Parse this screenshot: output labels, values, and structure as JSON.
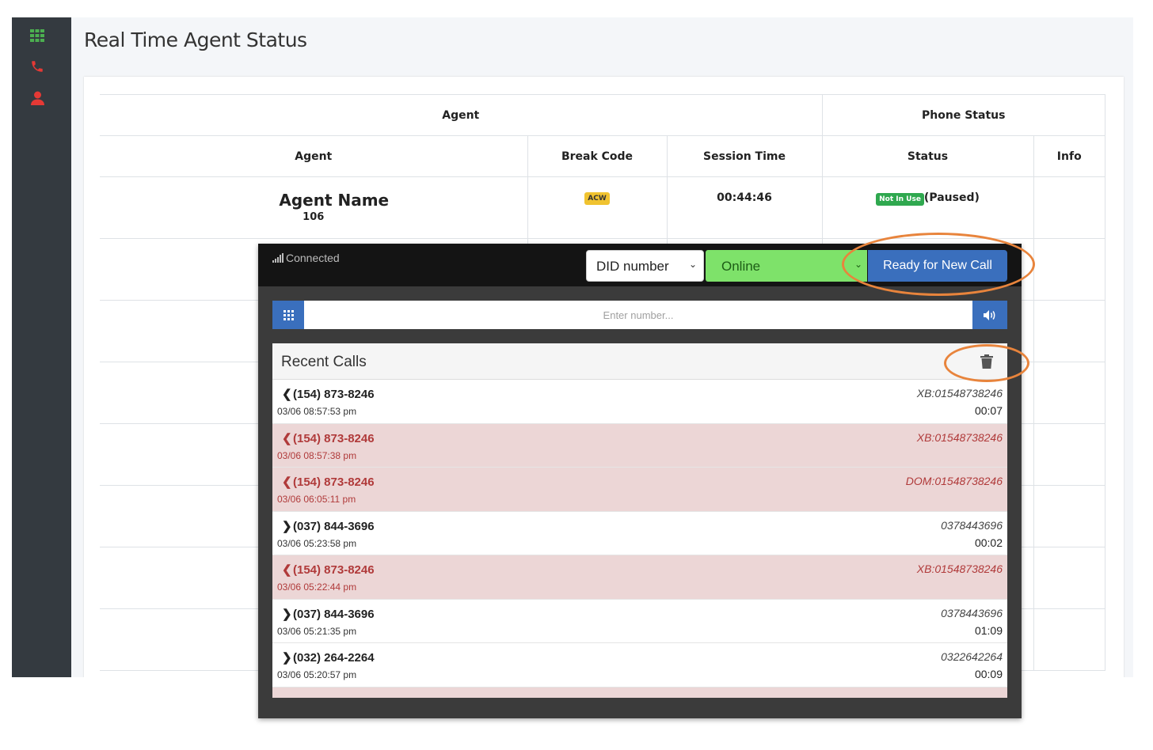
{
  "page": {
    "title": "Real Time Agent Status"
  },
  "sidebar": {
    "icons": [
      {
        "name": "grid-icon",
        "color": "#4caf50"
      },
      {
        "name": "phone-icon",
        "color": "#e53935"
      },
      {
        "name": "user-icon",
        "color": "#e53935"
      }
    ]
  },
  "table": {
    "group_headers": {
      "agent": "Agent",
      "phone_status": "Phone Status"
    },
    "columns": [
      "Agent",
      "Break Code",
      "Session Time",
      "Status",
      "Info"
    ],
    "row": {
      "agent_name": "Agent Name",
      "agent_ext": "106",
      "break_code": "ACW",
      "session_time": "00:44:46",
      "status_badge": "Not In Use",
      "status_text": "(Paused)",
      "info": ""
    }
  },
  "phone": {
    "connection": "Connected",
    "did_select": "DID number",
    "status_select": "Online",
    "ready_button": "Ready for New Call",
    "number_placeholder": "Enter number...",
    "recent_title": "Recent Calls",
    "colors": {
      "accent": "#3a6fbd",
      "online": "#7ee26a",
      "missed_bg": "#ecd6d6",
      "annotation": "#e8843c"
    },
    "calls": [
      {
        "direction": "in",
        "number": "(154) 873-8246",
        "when": "03/06 08:57:53 pm",
        "tag": "XB:01548738246",
        "duration": "00:07",
        "missed": false
      },
      {
        "direction": "in",
        "number": "(154) 873-8246",
        "when": "03/06 08:57:38 pm",
        "tag": "XB:01548738246",
        "duration": "",
        "missed": true
      },
      {
        "direction": "in",
        "number": "(154) 873-8246",
        "when": "03/06 06:05:11 pm",
        "tag": "DOM:01548738246",
        "duration": "",
        "missed": true
      },
      {
        "direction": "out",
        "number": "(037) 844-3696",
        "when": "03/06 05:23:58 pm",
        "tag": "0378443696",
        "duration": "00:02",
        "missed": false
      },
      {
        "direction": "in",
        "number": "(154) 873-8246",
        "when": "03/06 05:22:44 pm",
        "tag": "XB:01548738246",
        "duration": "",
        "missed": true
      },
      {
        "direction": "out",
        "number": "(037) 844-3696",
        "when": "03/06 05:21:35 pm",
        "tag": "0378443696",
        "duration": "01:09",
        "missed": false
      },
      {
        "direction": "out",
        "number": "(032) 264-2264",
        "when": "03/06 05:20:57 pm",
        "tag": "0322642264",
        "duration": "00:09",
        "missed": false
      }
    ]
  }
}
